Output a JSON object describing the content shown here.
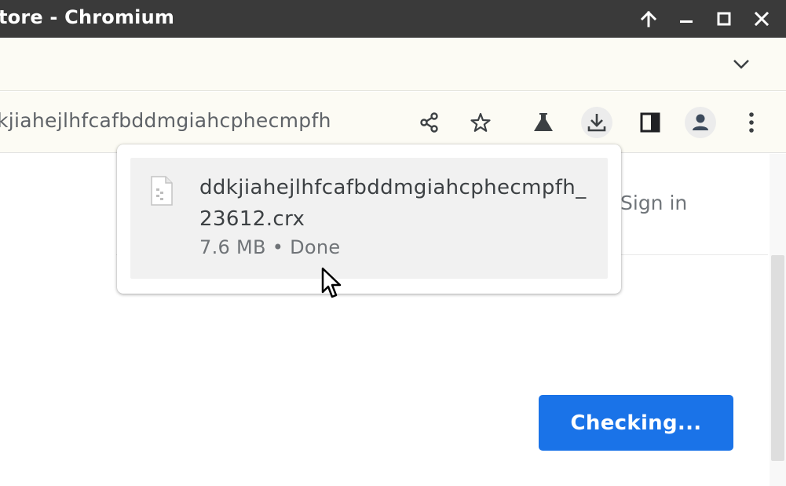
{
  "window": {
    "title": "tore - Chromium"
  },
  "toolbar": {
    "url": "kjiahejlhfcafbddmgiahcphecmpfh",
    "icons": [
      "share-icon",
      "star-icon",
      "labs-flask-icon",
      "download-icon",
      "side-panel-icon",
      "profile-avatar-icon",
      "more-menu-icon"
    ]
  },
  "download": {
    "filename": "ddkjiahejlhfcafbddmgiahcphecmpfh_23612.crx",
    "status": "7.6 MB • Done"
  },
  "page": {
    "sign_in": "Sign in",
    "checking_button": "Checking..."
  },
  "colors": {
    "titlebar": "#3a3a3a",
    "chrome_bg": "#fcfbf4",
    "accent": "#1a73e8",
    "download_item_bg": "#f1f1f1"
  }
}
